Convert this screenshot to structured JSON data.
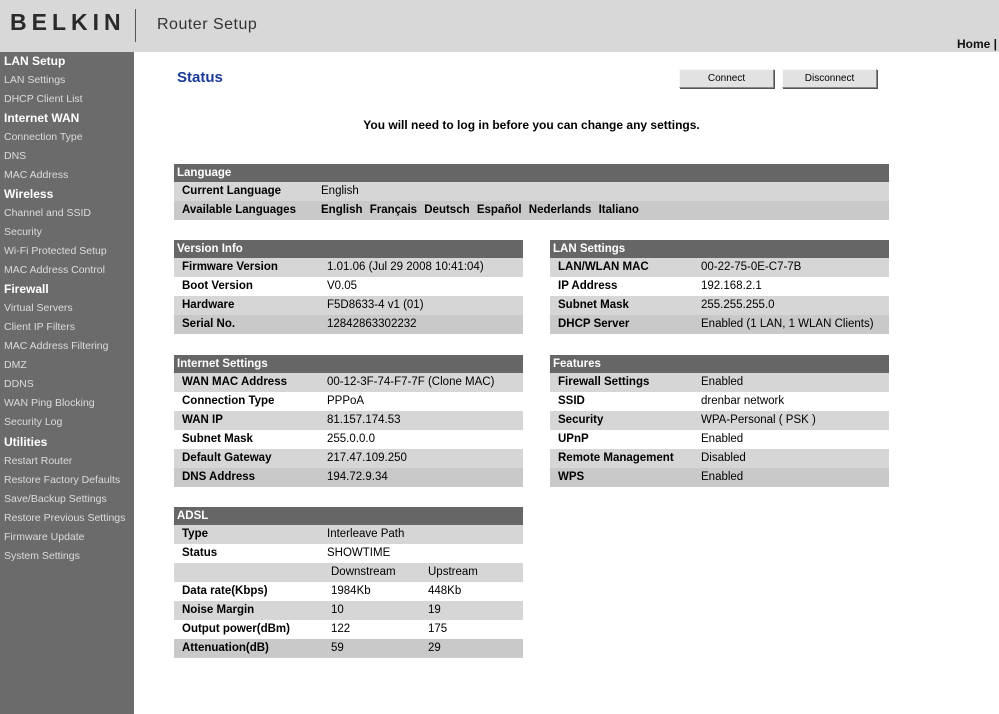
{
  "header": {
    "logo": "BELKIN",
    "title": "Router Setup",
    "home_link": "Home |"
  },
  "sidebar": {
    "sections": [
      {
        "title": "LAN Setup",
        "items": [
          "LAN Settings",
          "DHCP Client List"
        ]
      },
      {
        "title": "Internet WAN",
        "items": [
          "Connection Type",
          "DNS",
          "MAC Address"
        ]
      },
      {
        "title": "Wireless",
        "items": [
          "Channel and SSID",
          "Security",
          "Wi-Fi Protected Setup",
          "MAC Address Control"
        ]
      },
      {
        "title": "Firewall",
        "items": [
          "Virtual Servers",
          "Client IP Filters",
          "MAC Address Filtering",
          "DMZ",
          "DDNS",
          "WAN Ping Blocking",
          "Security Log"
        ]
      },
      {
        "title": "Utilities",
        "items": [
          "Restart Router",
          "Restore Factory Defaults",
          "Save/Backup Settings",
          "Restore Previous Settings",
          "Firmware Update",
          "System Settings"
        ]
      }
    ]
  },
  "main": {
    "title": "Status",
    "connect_label": "Connect",
    "disconnect_label": "Disconnect",
    "notice": "You will need to log in before you can change any settings."
  },
  "language": {
    "title": "Language",
    "current_label": "Current Language",
    "current_value": "English",
    "available_label": "Available Languages",
    "available": [
      "English",
      "Français",
      "Deutsch",
      "Español",
      "Nederlands",
      "Italiano"
    ]
  },
  "version_info": {
    "title": "Version Info",
    "rows": [
      {
        "label": "Firmware Version",
        "value": "1.01.06 (Jul 29 2008 10:41:04)"
      },
      {
        "label": "Boot Version",
        "value": "V0.05"
      },
      {
        "label": "Hardware",
        "value": "F5D8633-4 v1 (01)"
      },
      {
        "label": "Serial No.",
        "value": "12842863302232"
      }
    ]
  },
  "lan_settings": {
    "title": "LAN Settings",
    "rows": [
      {
        "label": "LAN/WLAN MAC",
        "value": "00-22-75-0E-C7-7B"
      },
      {
        "label": "IP Address",
        "value": "192.168.2.1"
      },
      {
        "label": "Subnet Mask",
        "value": "255.255.255.0"
      },
      {
        "label": "DHCP Server",
        "value": "Enabled (1 LAN, 1 WLAN Clients)"
      }
    ]
  },
  "internet_settings": {
    "title": "Internet Settings",
    "rows": [
      {
        "label": "WAN MAC Address",
        "value": "00-12-3F-74-F7-7F (Clone MAC)"
      },
      {
        "label": "Connection Type",
        "value": "PPPoA"
      },
      {
        "label": "WAN IP",
        "value": "81.157.174.53"
      },
      {
        "label": "Subnet Mask",
        "value": "255.0.0.0"
      },
      {
        "label": "Default Gateway",
        "value": "217.47.109.250"
      },
      {
        "label": "DNS Address",
        "value": "194.72.9.34"
      }
    ]
  },
  "features": {
    "title": "Features",
    "rows": [
      {
        "label": "Firewall Settings",
        "value": "Enabled"
      },
      {
        "label": "SSID",
        "value": "drenbar network"
      },
      {
        "label": "Security",
        "value": "WPA-Personal ( PSK )"
      },
      {
        "label": "UPnP",
        "value": "Enabled"
      },
      {
        "label": "Remote Management",
        "value": "Disabled"
      },
      {
        "label": "WPS",
        "value": "Enabled"
      }
    ]
  },
  "adsl": {
    "title": "ADSL",
    "type_label": "Type",
    "type_value": "Interleave Path",
    "status_label": "Status",
    "status_value": "SHOWTIME",
    "downstream_header": "Downstream",
    "upstream_header": "Upstream",
    "rows": [
      {
        "label": "Data rate(Kbps)",
        "down": "1984Kb",
        "up": "448Kb"
      },
      {
        "label": "Noise Margin",
        "down": "10",
        "up": "19"
      },
      {
        "label": "Output power(dBm)",
        "down": "122",
        "up": "175"
      },
      {
        "label": "Attenuation(dB)",
        "down": "59",
        "up": "29"
      }
    ]
  }
}
